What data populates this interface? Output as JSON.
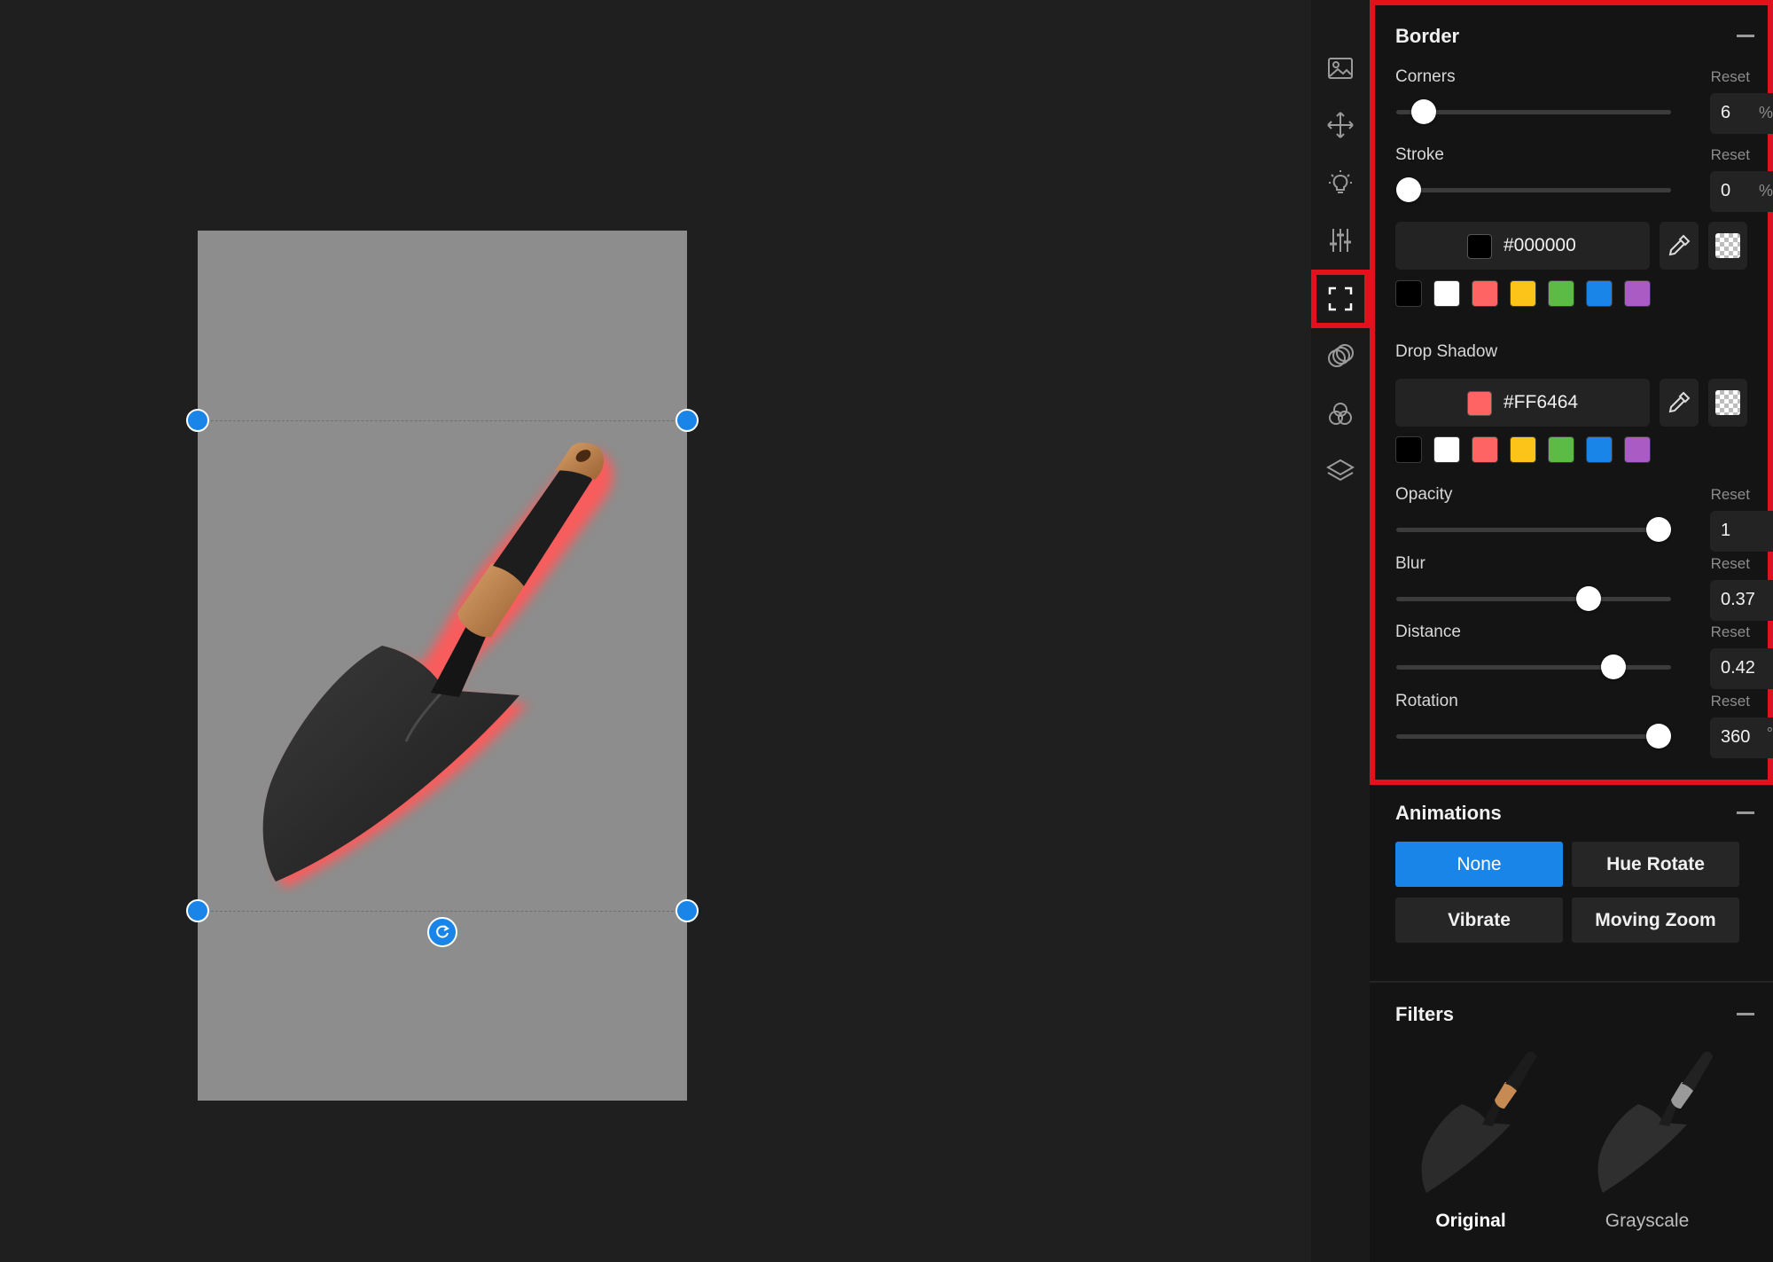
{
  "tools": [
    {
      "name": "image-icon",
      "active": false
    },
    {
      "name": "move-icon",
      "active": false
    },
    {
      "name": "lightbulb-icon",
      "active": false
    },
    {
      "name": "sliders-icon",
      "active": false
    },
    {
      "name": "frame-icon",
      "active": true
    },
    {
      "name": "blend-icon",
      "active": false
    },
    {
      "name": "color-channels-icon",
      "active": false
    },
    {
      "name": "layers-icon",
      "active": false
    }
  ],
  "border": {
    "title": "Border",
    "corners": {
      "label": "Corners",
      "reset": "Reset",
      "value": "6",
      "unit": "%",
      "fraction": 0.06
    },
    "stroke": {
      "label": "Stroke",
      "reset": "Reset",
      "value": "0",
      "unit": "%",
      "fraction": 0.0
    },
    "stroke_color": {
      "hex": "#000000"
    },
    "swatches": [
      "#000000",
      "#ffffff",
      "#ff6464",
      "#fcc419",
      "#5bbb45",
      "#1a85e8",
      "#ab5cc4"
    ]
  },
  "drop_shadow": {
    "label": "Drop Shadow",
    "color": {
      "hex": "#FF6464"
    },
    "swatches": [
      "#000000",
      "#ffffff",
      "#ff6464",
      "#fcc419",
      "#5bbb45",
      "#1a85e8",
      "#ab5cc4"
    ],
    "opacity": {
      "label": "Opacity",
      "reset": "Reset",
      "value": "1",
      "fraction": 1.0
    },
    "blur": {
      "label": "Blur",
      "reset": "Reset",
      "value": "0.37",
      "fraction": 0.72
    },
    "distance": {
      "label": "Distance",
      "reset": "Reset",
      "value": "0.42",
      "fraction": 0.82
    },
    "rotation": {
      "label": "Rotation",
      "reset": "Reset",
      "value": "360",
      "unit": "°",
      "fraction": 1.0
    }
  },
  "animations": {
    "title": "Animations",
    "options": [
      "None",
      "Hue Rotate",
      "Vibrate",
      "Moving Zoom"
    ],
    "selected": "None"
  },
  "filters": {
    "title": "Filters",
    "items": [
      {
        "label": "Original",
        "selected": true
      },
      {
        "label": "Grayscale",
        "selected": false
      }
    ]
  },
  "colors": {
    "accent": "#1a85e8",
    "highlight": "#e0121d",
    "shadow": "#FF6464"
  }
}
